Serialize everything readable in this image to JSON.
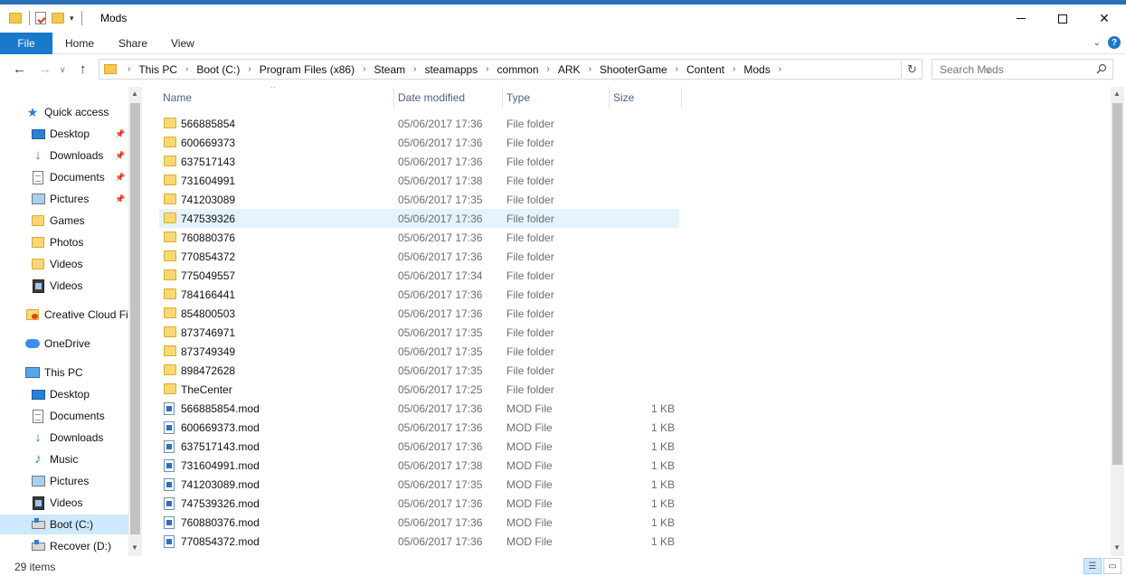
{
  "window": {
    "title": "Mods"
  },
  "ribbon": {
    "tabs": [
      "File",
      "Home",
      "Share",
      "View"
    ]
  },
  "address": {
    "crumbs": [
      "This PC",
      "Boot (C:)",
      "Program Files (x86)",
      "Steam",
      "steamapps",
      "common",
      "ARK",
      "ShooterGame",
      "Content",
      "Mods"
    ]
  },
  "search": {
    "placeholder": "Search Mods"
  },
  "sidebar": {
    "items": [
      {
        "label": "Quick access",
        "icon": "star-icon"
      },
      {
        "label": "Desktop",
        "icon": "desktop-icon",
        "pinned": true
      },
      {
        "label": "Downloads",
        "icon": "download-arrow-icon",
        "pinned": true
      },
      {
        "label": "Documents",
        "icon": "documents-icon",
        "pinned": true
      },
      {
        "label": "Pictures",
        "icon": "pictures-icon",
        "pinned": true
      },
      {
        "label": "Games",
        "icon": "folder-icon"
      },
      {
        "label": "Photos",
        "icon": "folder-icon"
      },
      {
        "label": "Videos",
        "icon": "folder-icon"
      },
      {
        "label": "Videos",
        "icon": "video-icon"
      },
      {
        "label": "Creative Cloud Fil",
        "icon": "creative-cloud-folder-icon"
      },
      {
        "label": "OneDrive",
        "icon": "onedrive-cloud-icon"
      },
      {
        "label": "This PC",
        "icon": "this-pc-icon"
      },
      {
        "label": "Desktop",
        "icon": "desktop-icon"
      },
      {
        "label": "Documents",
        "icon": "documents-icon"
      },
      {
        "label": "Downloads",
        "icon": "download-arrow-icon"
      },
      {
        "label": "Music",
        "icon": "music-icon"
      },
      {
        "label": "Pictures",
        "icon": "pictures-icon"
      },
      {
        "label": "Videos",
        "icon": "video-icon"
      },
      {
        "label": "Boot (C:)",
        "icon": "drive-icon",
        "selected": true
      },
      {
        "label": "Recover (D:)",
        "icon": "drive-icon"
      }
    ]
  },
  "columns": {
    "name": "Name",
    "date": "Date modified",
    "type": "Type",
    "size": "Size"
  },
  "files": [
    {
      "name": "566885854",
      "date": "05/06/2017 17:36",
      "type": "File folder",
      "size": "",
      "kind": "folder"
    },
    {
      "name": "600669373",
      "date": "05/06/2017 17:36",
      "type": "File folder",
      "size": "",
      "kind": "folder"
    },
    {
      "name": "637517143",
      "date": "05/06/2017 17:36",
      "type": "File folder",
      "size": "",
      "kind": "folder"
    },
    {
      "name": "731604991",
      "date": "05/06/2017 17:38",
      "type": "File folder",
      "size": "",
      "kind": "folder"
    },
    {
      "name": "741203089",
      "date": "05/06/2017 17:35",
      "type": "File folder",
      "size": "",
      "kind": "folder"
    },
    {
      "name": "747539326",
      "date": "05/06/2017 17:36",
      "type": "File folder",
      "size": "",
      "kind": "folder",
      "hover": true
    },
    {
      "name": "760880376",
      "date": "05/06/2017 17:36",
      "type": "File folder",
      "size": "",
      "kind": "folder"
    },
    {
      "name": "770854372",
      "date": "05/06/2017 17:36",
      "type": "File folder",
      "size": "",
      "kind": "folder"
    },
    {
      "name": "775049557",
      "date": "05/06/2017 17:34",
      "type": "File folder",
      "size": "",
      "kind": "folder"
    },
    {
      "name": "784166441",
      "date": "05/06/2017 17:36",
      "type": "File folder",
      "size": "",
      "kind": "folder"
    },
    {
      "name": "854800503",
      "date": "05/06/2017 17:36",
      "type": "File folder",
      "size": "",
      "kind": "folder"
    },
    {
      "name": "873746971",
      "date": "05/06/2017 17:35",
      "type": "File folder",
      "size": "",
      "kind": "folder"
    },
    {
      "name": "873749349",
      "date": "05/06/2017 17:35",
      "type": "File folder",
      "size": "",
      "kind": "folder"
    },
    {
      "name": "898472628",
      "date": "05/06/2017 17:35",
      "type": "File folder",
      "size": "",
      "kind": "folder"
    },
    {
      "name": "TheCenter",
      "date": "05/06/2017 17:25",
      "type": "File folder",
      "size": "",
      "kind": "folder"
    },
    {
      "name": "566885854.mod",
      "date": "05/06/2017 17:36",
      "type": "MOD File",
      "size": "1 KB",
      "kind": "mod"
    },
    {
      "name": "600669373.mod",
      "date": "05/06/2017 17:36",
      "type": "MOD File",
      "size": "1 KB",
      "kind": "mod"
    },
    {
      "name": "637517143.mod",
      "date": "05/06/2017 17:36",
      "type": "MOD File",
      "size": "1 KB",
      "kind": "mod"
    },
    {
      "name": "731604991.mod",
      "date": "05/06/2017 17:38",
      "type": "MOD File",
      "size": "1 KB",
      "kind": "mod"
    },
    {
      "name": "741203089.mod",
      "date": "05/06/2017 17:35",
      "type": "MOD File",
      "size": "1 KB",
      "kind": "mod"
    },
    {
      "name": "747539326.mod",
      "date": "05/06/2017 17:36",
      "type": "MOD File",
      "size": "1 KB",
      "kind": "mod"
    },
    {
      "name": "760880376.mod",
      "date": "05/06/2017 17:36",
      "type": "MOD File",
      "size": "1 KB",
      "kind": "mod"
    },
    {
      "name": "770854372.mod",
      "date": "05/06/2017 17:36",
      "type": "MOD File",
      "size": "1 KB",
      "kind": "mod"
    }
  ],
  "status": {
    "item_count": "29 items"
  },
  "colors": {
    "accent": "#1979ca",
    "hover_row": "#e5f3ff",
    "selected_nav": "#cde8ff"
  }
}
